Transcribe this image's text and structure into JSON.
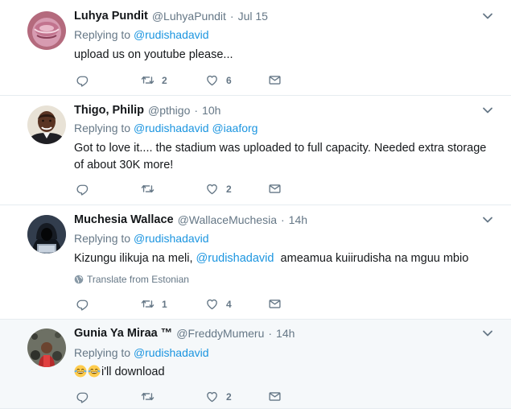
{
  "tweets": [
    {
      "name": "Luhya Pundit",
      "handle": "@LuhyaPundit",
      "separator": "·",
      "time": "Jul 15",
      "replying_prefix": "Replying to",
      "replying_to": [
        "@rudishadavid"
      ],
      "text": "upload us on youtube please...",
      "retweets": "2",
      "likes": "6"
    },
    {
      "name": "Thigo, Philip",
      "handle": "@pthigo",
      "separator": "·",
      "time": "10h",
      "replying_prefix": "Replying to",
      "replying_to": [
        "@rudishadavid",
        "@iaaforg"
      ],
      "text": "Got to love it.... the stadium was uploaded to full capacity. Needed extra storage of about 30K more!",
      "retweets": "",
      "likes": "2"
    },
    {
      "name": "Muchesia Wallace",
      "handle": "@WallaceMuchesia",
      "separator": "·",
      "time": "14h",
      "replying_prefix": "Replying to",
      "replying_to": [
        "@rudishadavid"
      ],
      "text_before": "Kizungu ilikuja na meli,",
      "text_mention": "@rudishadavid",
      "text_after": "ameamua kuiirudisha na mguu mbio",
      "translate_label": "Translate from Estonian",
      "retweets": "1",
      "likes": "4"
    },
    {
      "name": "Gunia Ya Miraa ™",
      "handle": "@FreddyMumeru",
      "separator": "·",
      "time": "14h",
      "replying_prefix": "Replying to",
      "replying_to": [
        "@rudishadavid"
      ],
      "text": "i'll download",
      "emoji_name": "face-with-tears-of-joy",
      "retweets": "",
      "likes": "2"
    }
  ],
  "colors": {
    "link": "#1b95e0",
    "secondary": "#657786",
    "divider": "#e6ecf0",
    "highlight_bg": "#f5f8fa"
  }
}
